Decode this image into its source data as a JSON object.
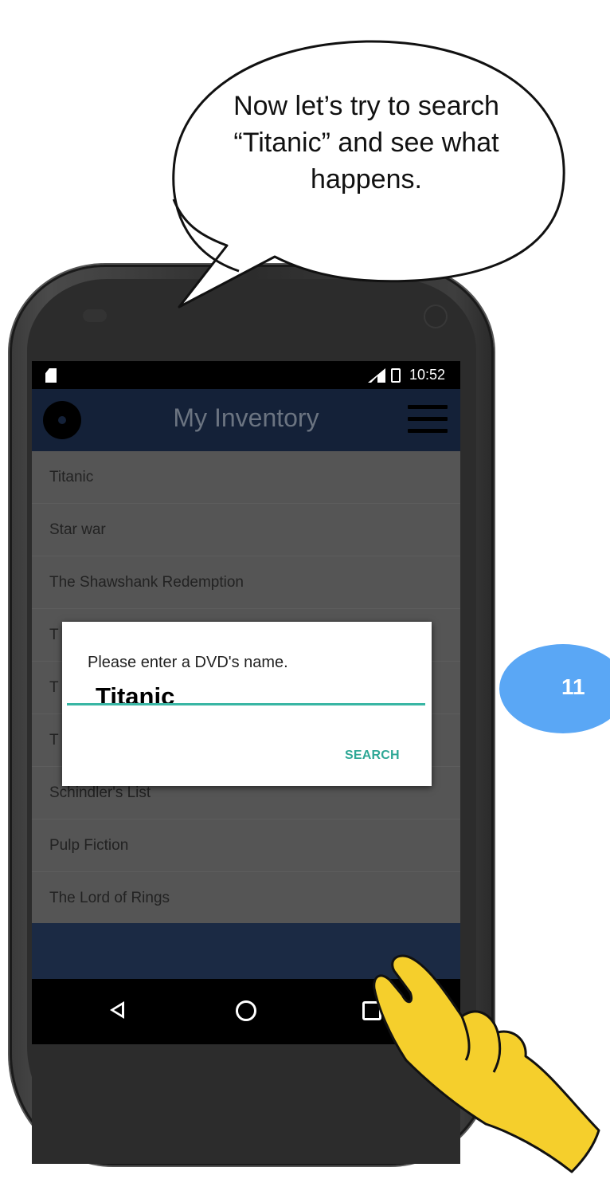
{
  "callout": {
    "lines": [
      "Now let’s try to search",
      "“Titanic” and see what",
      "happens."
    ]
  },
  "status_bar": {
    "time": "10:52"
  },
  "app_bar": {
    "title": "My Inventory"
  },
  "inventory": {
    "items": [
      "Titanic",
      "Star war",
      "The Shawshank Redemption",
      "T",
      "T",
      "T",
      "Schindler's List",
      "Pulp Fiction",
      "The Lord of Rings"
    ]
  },
  "dialog": {
    "message": "Please enter a DVD's name.",
    "input_value": "Titanic",
    "search_label": "SEARCH"
  },
  "step": {
    "number": "11",
    "color": "#5aa7f5"
  },
  "colors": {
    "accent": "#39b6a4",
    "app_bar": "#142138",
    "hand": "#f5cf2c"
  }
}
